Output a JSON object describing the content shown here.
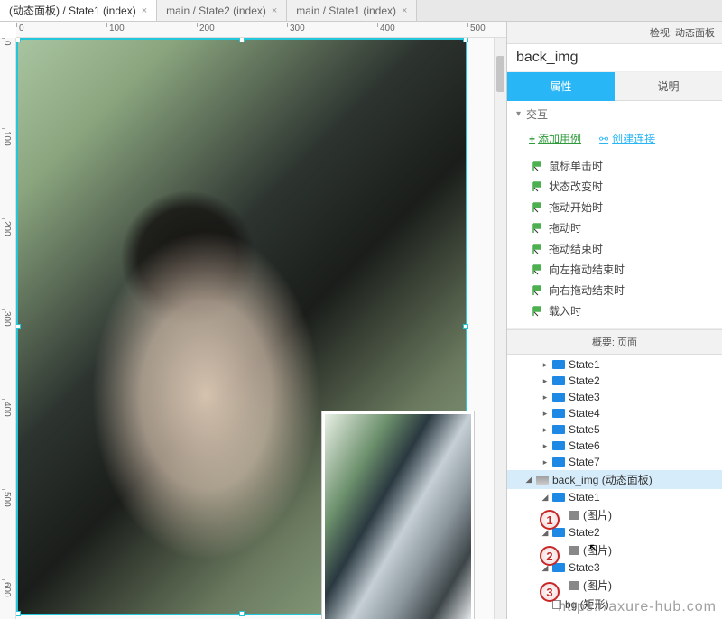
{
  "tabs": [
    {
      "label": "(动态面板) / State1 (index)",
      "active": true
    },
    {
      "label": "main / State2 (index)",
      "active": false
    },
    {
      "label": "main / State1 (index)",
      "active": false
    }
  ],
  "inspector": {
    "header": "检视: 动态面板",
    "element_name": "back_img",
    "prop_tabs": {
      "properties": "属性",
      "notes": "说明"
    },
    "interactions_label": "交互",
    "add_case": "添加用例",
    "create_link": "创建连接",
    "events": [
      "鼠标单击时",
      "状态改变时",
      "拖动开始时",
      "拖动时",
      "拖动结束时",
      "向左拖动结束时",
      "向右拖动结束时",
      "载入时"
    ]
  },
  "outline": {
    "header": "概要: 页面",
    "states": [
      "State1",
      "State2",
      "State3",
      "State4",
      "State5",
      "State6",
      "State7"
    ],
    "selected": {
      "name": "back_img",
      "type_suffix": "(动态面板)"
    },
    "image_suffix": "(图片)",
    "rect_suffix": "(矩形)",
    "child_states": [
      "State1",
      "State2",
      "State3"
    ],
    "bg_name": "bg"
  },
  "ruler_ticks_h": [
    "0",
    "100",
    "200",
    "300",
    "400",
    "500"
  ],
  "ruler_ticks_v": [
    "0",
    "100",
    "200",
    "300",
    "400",
    "500",
    "600"
  ],
  "badges": [
    "1",
    "2",
    "3"
  ],
  "watermark": "https://axure-hub.com"
}
